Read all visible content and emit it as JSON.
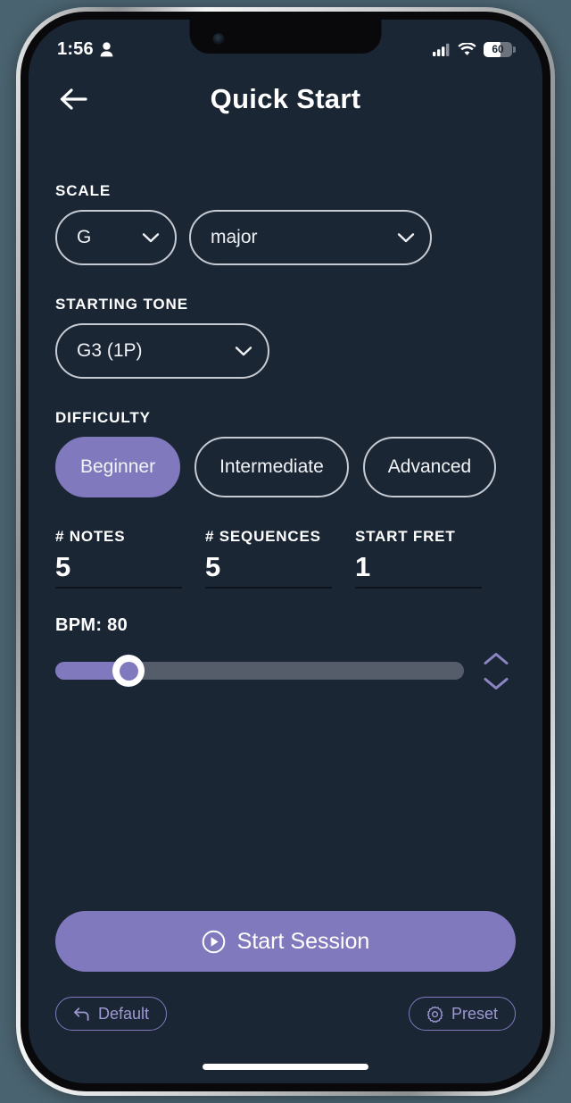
{
  "status_bar": {
    "time": "1:56",
    "person_icon": "person-icon",
    "cellular_icon": "cellular-signal-icon",
    "wifi_icon": "wifi-icon",
    "battery_level": "60",
    "battery_percent": 60
  },
  "header": {
    "back_icon": "arrow-left-icon",
    "title": "Quick Start"
  },
  "scale": {
    "label": "SCALE",
    "root": {
      "value": "G",
      "chevron_icon": "chevron-down-icon"
    },
    "type": {
      "value": "major",
      "chevron_icon": "chevron-down-icon"
    }
  },
  "starting_tone": {
    "label": "STARTING TONE",
    "value": "G3 (1P)",
    "chevron_icon": "chevron-down-icon"
  },
  "difficulty": {
    "label": "DIFFICULTY",
    "options": [
      {
        "label": "Beginner",
        "selected": true
      },
      {
        "label": "Intermediate",
        "selected": false
      },
      {
        "label": "Advanced",
        "selected": false
      }
    ]
  },
  "numbers": [
    {
      "label": "# NOTES",
      "value": "5"
    },
    {
      "label": "# SEQUENCES",
      "value": "5"
    },
    {
      "label": "START FRET",
      "value": "1"
    }
  ],
  "bpm": {
    "label": "BPM: 80",
    "value": 80,
    "fill_percent": 18,
    "stepper_up_icon": "chevron-up-icon",
    "stepper_down_icon": "chevron-down-icon"
  },
  "start_session": {
    "label": "Start Session",
    "icon": "play-circle-icon"
  },
  "bottom_actions": [
    {
      "label": "Default",
      "icon": "undo-arrow-icon"
    },
    {
      "label": "Preset",
      "icon": "gear-icon"
    }
  ],
  "colors": {
    "screen_background": "#1b2634",
    "accent_purple": "#8079bd",
    "ghost_purple": "#9e98d2",
    "border_light": "#c6cad2",
    "slider_track": "#555d6b",
    "outer_background": "#4a6370"
  }
}
